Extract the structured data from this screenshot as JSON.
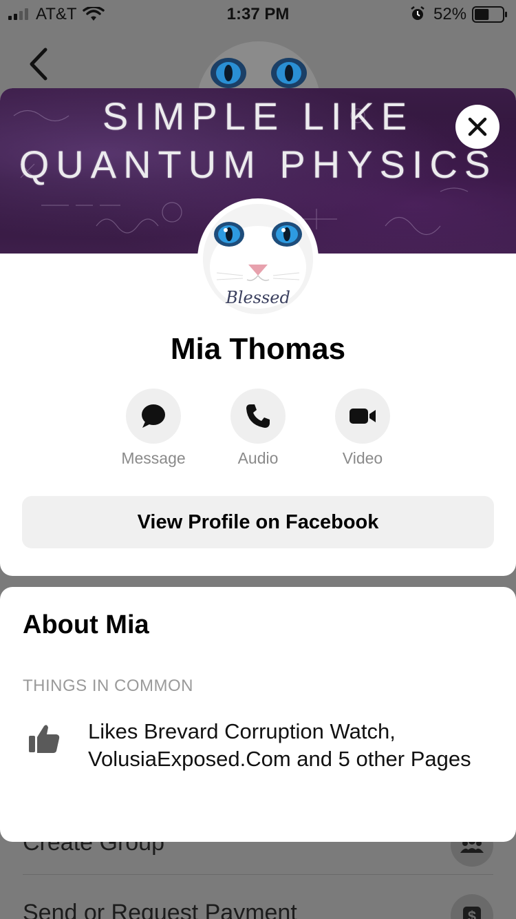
{
  "status_bar": {
    "carrier": "AT&T",
    "time": "1:37 PM",
    "battery_percent": "52%",
    "battery_level": 0.52
  },
  "cover": {
    "line1": "SIMPLE LIKE",
    "line2": "QUANTUM PHYSICS"
  },
  "avatar": {
    "caption": "Blessed"
  },
  "profile": {
    "name": "Mia Thomas",
    "actions": [
      {
        "label": "Message",
        "icon": "message-bubble-icon"
      },
      {
        "label": "Audio",
        "icon": "phone-icon"
      },
      {
        "label": "Video",
        "icon": "video-camera-icon"
      }
    ],
    "view_profile_label": "View Profile on Facebook"
  },
  "about": {
    "title": "About Mia",
    "section_label": "THINGS IN COMMON",
    "common_text": "Likes Brevard Corruption Watch, VolusiaExposed.Com and 5 other Pages"
  },
  "background_rows": [
    {
      "label": "Create Group",
      "icon": "group-icon"
    },
    {
      "label": "Send or Request Payment",
      "icon": "dollar-icon"
    }
  ],
  "colors": {
    "overlay": "#7b7b7b",
    "card": "#ffffff",
    "button_bg": "#f0f0f0",
    "muted_text": "#8a8a8a"
  }
}
